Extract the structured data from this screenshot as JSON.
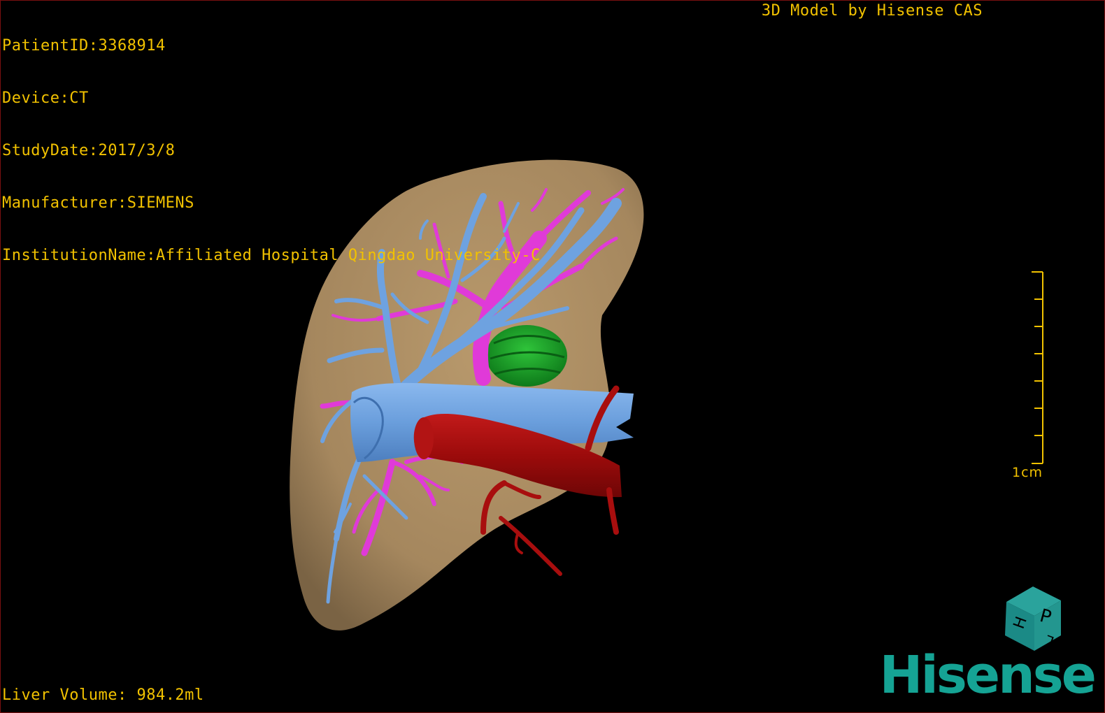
{
  "patient_info": {
    "patient_id": {
      "label": "PatientID",
      "sep": ":",
      "value": "3368914"
    },
    "device": {
      "label": "Device",
      "sep": ":",
      "value": "CT"
    },
    "study_date": {
      "label": "StudyDate",
      "sep": ":",
      "value": "2017/3/8"
    },
    "manufacturer": {
      "label": "Manufacturer",
      "sep": ":",
      "value": "SIEMENS"
    },
    "institution": {
      "label": "InstitutionName",
      "sep": ":",
      "value": "Affiliated Hospital Qingdao University-C"
    }
  },
  "credit": "3D Model by Hisense CAS",
  "scale_bar": {
    "label": "1cm"
  },
  "liver_volume": {
    "label": "Liver Volume",
    "sep": ": ",
    "value": "984.2ml"
  },
  "orientation_cube": {
    "face_front": "P",
    "face_left": "H",
    "face_right": "L"
  },
  "logo": "Hisense",
  "colors": {
    "overlay_text": "#f2c200",
    "background": "#000000",
    "liver": "#a88a62",
    "portal_vein": "#6ea2e0",
    "hepatic_artery_branches": "#e03ad8",
    "artery": "#a00c0c",
    "tumor": "#1aa02a",
    "logo": "#15a394",
    "cube": "#1b8a86"
  }
}
